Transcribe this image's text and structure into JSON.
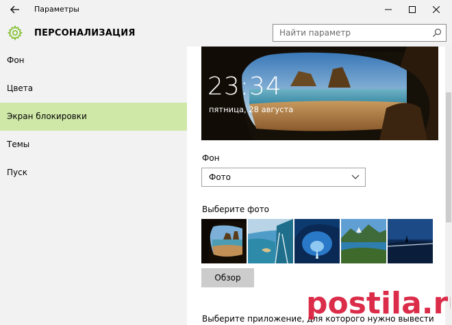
{
  "window": {
    "title": "Параметры"
  },
  "header": {
    "title": "ПЕРСОНАЛИЗАЦИЯ",
    "search_placeholder": "Найти параметр"
  },
  "sidebar": {
    "items": [
      {
        "label": "Фон",
        "selected": false
      },
      {
        "label": "Цвета",
        "selected": false
      },
      {
        "label": "Экран блокировки",
        "selected": true
      },
      {
        "label": "Темы",
        "selected": false
      },
      {
        "label": "Пуск",
        "selected": false
      }
    ]
  },
  "lock_preview": {
    "time": "23:34",
    "date": "пятница, 28 августа"
  },
  "background": {
    "label": "Фон",
    "value": "Фото"
  },
  "photos": {
    "label": "Выберите фото",
    "browse_label": "Обзор"
  },
  "app_section": {
    "label": "Выберите приложение, для которого нужно вывести"
  },
  "watermark": "postila.ru",
  "colors": {
    "accent": "#7fbf2a",
    "selected_bg": "#cfe8a8",
    "watermark": "#d81b3a"
  }
}
